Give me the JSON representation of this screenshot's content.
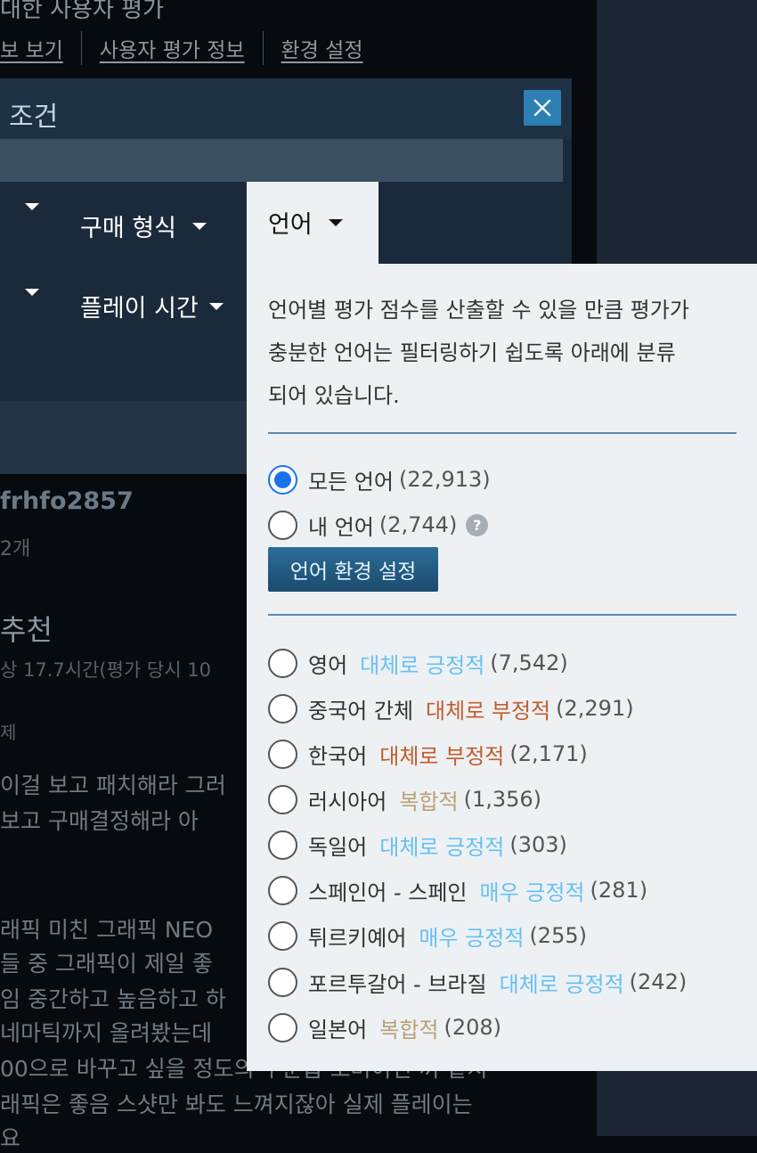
{
  "header": {
    "title": "대한 사용자 평가",
    "links": [
      "보 보기",
      "사용자 평가 정보",
      "환경 설정"
    ]
  },
  "dialog": {
    "title": "조건",
    "tabs": [
      {
        "label": "구매 형식"
      },
      {
        "label": "언어"
      },
      {
        "label": "플레이 시간"
      }
    ]
  },
  "review": {
    "username": "frhfo2857",
    "reviews_count": "2개",
    "verdict": "추천",
    "playtime": "상 17.7시간(평가 당시 10",
    "small_note": "제",
    "lines": [
      "이걸 보고 패치해라 그러",
      "보고 구매결정해라 아",
      "래픽 미친 그래픽 NEO",
      "들 중 그래픽이 제일 좋",
      "임 중간하고 높음하고 하",
      "네마틱까지 올려봤는데",
      "00으로 바꾸고 싶을 정도의 수준급 오버이연 꺼 같지",
      "래픽은 좋음 스샷만 봐도 느껴지잖아 실제 플레이는",
      "요"
    ]
  },
  "language_filter": {
    "description": [
      "언어별 평가 점수를 산출할 수 있을 만큼 평가가",
      "충분한 언어는 필터링하기 쉽도록 아래에 분류",
      "되어 있습니다."
    ],
    "all_languages": {
      "label": "모든 언어",
      "count": "(22,913)",
      "selected": true
    },
    "my_languages": {
      "label": "내 언어",
      "count": "(2,744)",
      "help": "?"
    },
    "pref_button": "언어 환경 설정",
    "languages": [
      {
        "name": "영어",
        "rating": "대체로 긍정적",
        "count": "(7,542)",
        "tone": "pos"
      },
      {
        "name": "중국어 간체",
        "rating": "대체로 부정적",
        "count": "(2,291)",
        "tone": "neg"
      },
      {
        "name": "한국어",
        "rating": "대체로 부정적",
        "count": "(2,171)",
        "tone": "neg"
      },
      {
        "name": "러시아어",
        "rating": "복합적",
        "count": "(1,356)",
        "tone": "mixed"
      },
      {
        "name": "독일어",
        "rating": "대체로 긍정적",
        "count": "(303)",
        "tone": "pos"
      },
      {
        "name": "스페인어 - 스페인",
        "rating": "매우 긍정적",
        "count": "(281)",
        "tone": "pos"
      },
      {
        "name": "튀르키예어",
        "rating": "매우 긍정적",
        "count": "(255)",
        "tone": "pos"
      },
      {
        "name": "포르투갈어 - 브라질",
        "rating": "대체로 긍정적",
        "count": "(242)",
        "tone": "pos"
      },
      {
        "name": "일본어",
        "rating": "복합적",
        "count": "(208)",
        "tone": "mixed"
      }
    ]
  },
  "colors": {
    "positive": "#66c0f4",
    "negative": "#c35c2c",
    "mixed": "#b9a074",
    "accent": "#1a73e8"
  }
}
